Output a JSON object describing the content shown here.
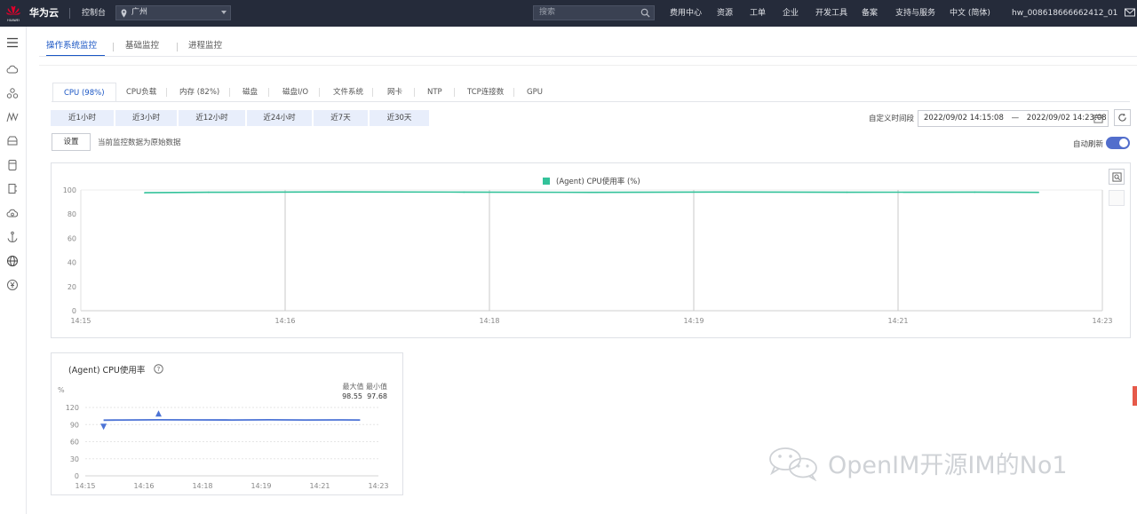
{
  "topbar": {
    "brand_mark": "HUAWEI",
    "brand": "华为云",
    "console": "控制台",
    "region": "广州",
    "search_placeholder": "搜索",
    "links": [
      "费用中心",
      "资源",
      "工单",
      "企业",
      "开发工具",
      "备案",
      "支持与服务",
      "中文 (简体)"
    ],
    "account": "hw_008618666662412_01"
  },
  "sidebar": {
    "icons": [
      "menu-icon",
      "cloud-icon",
      "network-icon",
      "function-icon",
      "storage-icon",
      "database-icon",
      "server-icon",
      "cloud-service-icon",
      "anchor-icon",
      "globe-icon",
      "currency-icon"
    ]
  },
  "main_tabs": {
    "items": [
      "操作系统监控",
      "基础监控",
      "进程监控"
    ],
    "active": 0
  },
  "metric_tabs": {
    "items": [
      "CPU (98%)",
      "CPU负载",
      "内存 (82%)",
      "磁盘",
      "磁盘I/O",
      "文件系统",
      "网卡",
      "NTP",
      "TCP连接数",
      "GPU"
    ],
    "active": 0
  },
  "time_ranges": [
    "近1小时",
    "近3小时",
    "近12小时",
    "近24小时",
    "近7天",
    "近30天"
  ],
  "custom_range": {
    "label": "自定义时间段",
    "start": "2022/09/02 14:15:08",
    "separator": "—",
    "end": "2022/09/02 14:23:08"
  },
  "settings_button": "设置",
  "raw_data_note": "当前监控数据为原始数据",
  "auto_refresh": {
    "label": "自动刷新",
    "enabled": true
  },
  "colors": {
    "topbar": "#252b3a",
    "accent": "#1a56c4",
    "series_main": "#33c29a",
    "series_mini": "#4d74d6",
    "toggle": "#526ecc"
  },
  "chart_data": [
    {
      "type": "line",
      "title": "",
      "legend": [
        "(Agent) CPU使用率 (%)"
      ],
      "legend_position": "top-center",
      "grid": true,
      "xlabel": "",
      "ylabel": "",
      "x_ticks": [
        "14:15",
        "14:16",
        "14:18",
        "14:19",
        "14:21",
        "14:23"
      ],
      "y_ticks": [
        0,
        20,
        40,
        60,
        80,
        100
      ],
      "ylim": [
        0,
        100
      ],
      "series": [
        {
          "name": "(Agent) CPU使用率 (%)",
          "x": [
            "14:15:30",
            "14:16:00",
            "14:17:00",
            "14:18:00",
            "14:19:00",
            "14:20:00",
            "14:21:00",
            "14:22:00",
            "14:22:30"
          ],
          "values": [
            97.7,
            98.1,
            98.4,
            98.2,
            98.0,
            98.3,
            98.1,
            98.2,
            98.0
          ]
        }
      ]
    },
    {
      "type": "line",
      "title": "(Agent) CPU使用率",
      "unit": "%",
      "stats_labels": [
        "最大值",
        "最小值"
      ],
      "stats_values": [
        "98.55",
        "97.68"
      ],
      "grid": true,
      "x_ticks": [
        "14:15",
        "14:16",
        "14:18",
        "14:19",
        "14:21",
        "14:23"
      ],
      "y_ticks": [
        0,
        30,
        60,
        90,
        120
      ],
      "ylim": [
        0,
        120
      ],
      "series": [
        {
          "name": "(Agent) CPU使用率",
          "x": [
            "14:15:30",
            "14:16:00",
            "14:17:00",
            "14:18:00",
            "14:19:00",
            "14:20:00",
            "14:21:00",
            "14:22:00",
            "14:22:30"
          ],
          "values": [
            97.7,
            98.1,
            98.4,
            98.2,
            98.0,
            98.3,
            98.1,
            98.2,
            98.0
          ],
          "max_marker_x": "14:17:00",
          "min_marker_x": "14:15:30"
        }
      ]
    }
  ],
  "watermark": "OpenIM开源IM的No1"
}
